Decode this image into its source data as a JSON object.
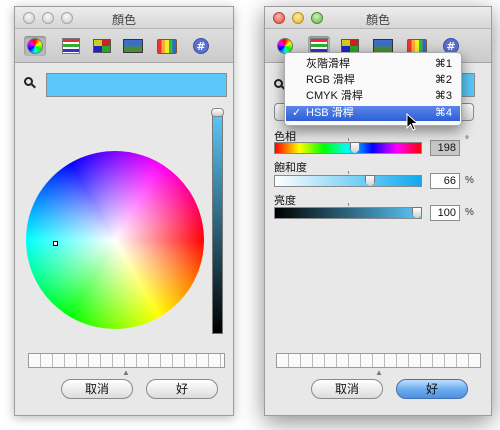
{
  "window_left": {
    "title": "顏色",
    "toolbar": [
      "color-wheel",
      "color-sliders",
      "color-palettes",
      "image-palettes",
      "crayons",
      "hex-picker"
    ],
    "selected_color": "#5ac8fa",
    "buttons": {
      "cancel": "取消",
      "ok": "好"
    }
  },
  "window_right": {
    "title": "顏色",
    "menu": {
      "items": [
        {
          "label": "灰階滑桿",
          "shortcut": "⌘1",
          "checked": false
        },
        {
          "label": "RGB 滑桿",
          "shortcut": "⌘2",
          "checked": false
        },
        {
          "label": "CMYK 滑桿",
          "shortcut": "⌘3",
          "checked": false
        },
        {
          "label": "HSB 滑桿",
          "shortcut": "⌘4",
          "checked": true
        }
      ],
      "checkmark": "✓"
    },
    "sliders": {
      "hue": {
        "label": "色相",
        "value": "198",
        "unit": "°",
        "position": 198,
        "max": 360
      },
      "saturation": {
        "label": "飽和度",
        "value": "66",
        "unit": "%",
        "position": 66,
        "max": 100
      },
      "brightness": {
        "label": "亮度",
        "value": "100",
        "unit": "%",
        "position": 100,
        "max": 100
      }
    },
    "buttons": {
      "cancel": "取消",
      "ok": "好"
    }
  }
}
